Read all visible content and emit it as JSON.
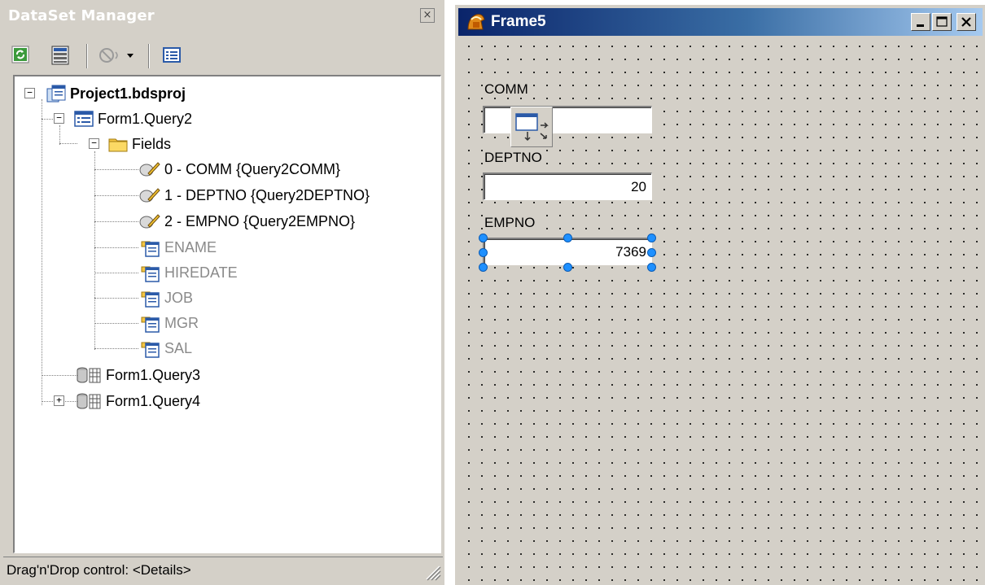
{
  "dataset_manager": {
    "title": "DataSet Manager",
    "close_glyph": "×",
    "toolbar": [
      "refresh-icon",
      "dataset-icon",
      "drag-mode-icon",
      "dropdown-arrow-icon",
      "field-list-icon"
    ],
    "tree": {
      "project": "Project1.bdsproj",
      "query2": "Form1.Query2",
      "fields_folder": "Fields",
      "persistent_fields": [
        "0 - COMM {Query2COMM}",
        "1 - DEPTNO {Query2DEPTNO}",
        "2 - EMPNO {Query2EMPNO}"
      ],
      "available_fields": [
        "ENAME",
        "HIREDATE",
        "JOB",
        "MGR",
        "SAL"
      ],
      "query3": "Form1.Query3",
      "query4": "Form1.Query4"
    },
    "status": "Drag'n'Drop control: <Details>"
  },
  "frame": {
    "title": "Frame5",
    "fields": [
      {
        "label": "COMM",
        "value": ""
      },
      {
        "label": "DEPTNO",
        "value": "20"
      },
      {
        "label": "EMPNO",
        "value": "7369"
      }
    ]
  },
  "colors": {
    "titlebar_start": "#0a246a",
    "titlebar_end": "#a6caf0",
    "face": "#d4d0c8",
    "selection_handle": "#1e90ff"
  }
}
